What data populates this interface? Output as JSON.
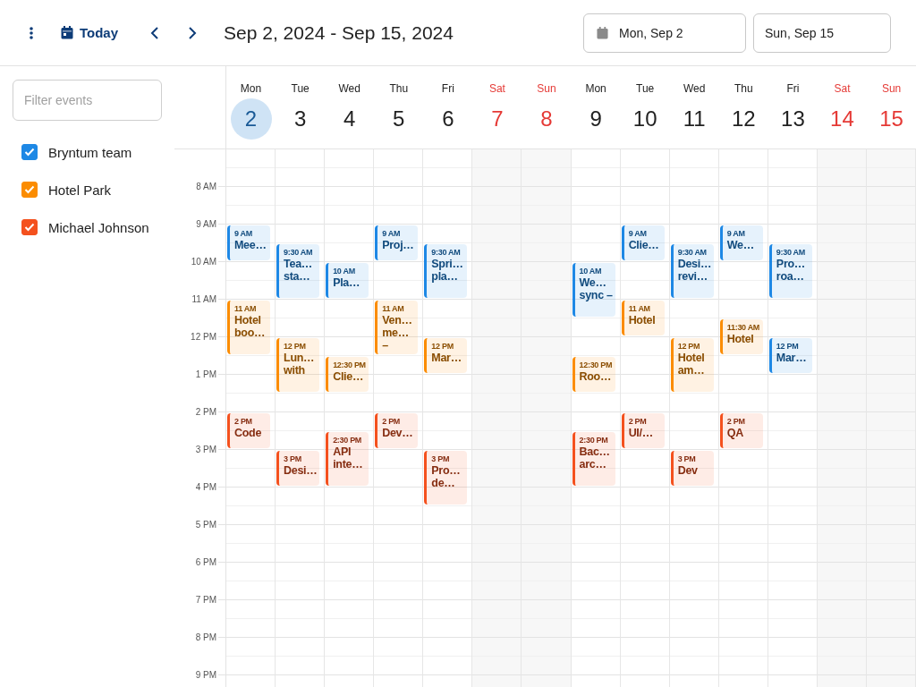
{
  "toolbar": {
    "today": "Today",
    "range": "Sep 2, 2024 - Sep 15, 2024",
    "start_date": "Mon, Sep 2",
    "end_date": "Sun, Sep 15"
  },
  "sidebar": {
    "filter_placeholder": "Filter events"
  },
  "calendars": [
    {
      "name": "Bryntum team",
      "checked": true,
      "color": "#1e88e5"
    },
    {
      "name": "Hotel Park",
      "checked": true,
      "color": "#fb8c00"
    },
    {
      "name": "Michael Johnson",
      "checked": true,
      "color": "#f4511e"
    }
  ],
  "days": [
    {
      "dow": "Mon",
      "date": "2",
      "weekend": false,
      "selected": true,
      "events": [
        {
          "color": "#1e88e5",
          "kind": "short",
          "time": "9 AM",
          "title": "Mee…"
        },
        {
          "color": "#fb8c00",
          "kind": "long",
          "time": "11 AM",
          "title": "Hotel boo…"
        },
        {
          "color": "#f4511e",
          "kind": "short",
          "time": "2 PM",
          "title": "Code"
        }
      ]
    },
    {
      "dow": "Tue",
      "date": "3",
      "weekend": false,
      "selected": false,
      "events": [
        {
          "color": "#1e88e5",
          "kind": "long",
          "time": "9:30 AM",
          "title": "Tea… sta…"
        },
        {
          "color": "#fb8c00",
          "kind": "long",
          "time": "12 PM",
          "title": "Lun… with"
        },
        {
          "color": "#f4511e",
          "kind": "short",
          "time": "3 PM",
          "title": "Desi…"
        }
      ]
    },
    {
      "dow": "Wed",
      "date": "4",
      "weekend": false,
      "selected": false,
      "events": [
        {
          "color": "#1e88e5",
          "kind": "short",
          "time": "10 AM",
          "title": "Pla…"
        },
        {
          "color": "#fb8c00",
          "kind": "short",
          "time": "12:30 PM",
          "title": "Clie…"
        },
        {
          "color": "#f4511e",
          "kind": "long",
          "time": "2:30 PM",
          "title": "API inte…"
        }
      ]
    },
    {
      "dow": "Thu",
      "date": "5",
      "weekend": false,
      "selected": false,
      "events": [
        {
          "color": "#1e88e5",
          "kind": "short",
          "time": "9 AM",
          "title": "Proj…"
        },
        {
          "color": "#fb8c00",
          "kind": "long",
          "time": "11 AM",
          "title": "Ven… me… –"
        },
        {
          "color": "#f4511e",
          "kind": "short",
          "time": "2 PM",
          "title": "Dev…"
        }
      ]
    },
    {
      "dow": "Fri",
      "date": "6",
      "weekend": false,
      "selected": false,
      "events": [
        {
          "color": "#1e88e5",
          "kind": "long",
          "time": "9:30 AM",
          "title": "Spri… pla…"
        },
        {
          "color": "#fb8c00",
          "kind": "short",
          "time": "12 PM",
          "title": "Mar…"
        },
        {
          "color": "#f4511e",
          "kind": "long",
          "time": "3 PM",
          "title": "Pro… de…"
        }
      ]
    },
    {
      "dow": "Sat",
      "date": "7",
      "weekend": true,
      "selected": false
    },
    {
      "dow": "Sun",
      "date": "8",
      "weekend": true,
      "selected": false
    },
    {
      "dow": "Mon",
      "date": "9",
      "weekend": false,
      "selected": false,
      "events": [
        {
          "color": "#1e88e5",
          "kind": "long",
          "time": "10 AM",
          "title": "We… sync –"
        },
        {
          "color": "#fb8c00",
          "kind": "short",
          "time": "12:30 PM",
          "title": "Roo…"
        },
        {
          "color": "#f4511e",
          "kind": "long",
          "time": "2:30 PM",
          "title": "Bac… arc…"
        }
      ]
    },
    {
      "dow": "Tue",
      "date": "10",
      "weekend": false,
      "selected": false,
      "events": [
        {
          "color": "#1e88e5",
          "kind": "short",
          "time": "9 AM",
          "title": "Clie…"
        },
        {
          "color": "#fb8c00",
          "kind": "short",
          "time": "11 AM",
          "title": "Hotel"
        },
        {
          "color": "#f4511e",
          "kind": "short",
          "time": "2 PM",
          "title": "UI/…"
        }
      ]
    },
    {
      "dow": "Wed",
      "date": "11",
      "weekend": false,
      "selected": false,
      "events": [
        {
          "color": "#1e88e5",
          "kind": "long",
          "time": "9:30 AM",
          "title": "Desi… revi…"
        },
        {
          "color": "#fb8c00",
          "kind": "long",
          "time": "12 PM",
          "title": "Hotel am…"
        },
        {
          "color": "#f4511e",
          "kind": "short",
          "time": "3 PM",
          "title": "Dev"
        }
      ]
    },
    {
      "dow": "Thu",
      "date": "12",
      "weekend": false,
      "selected": false,
      "events": [
        {
          "color": "#1e88e5",
          "kind": "short",
          "time": "9 AM",
          "title": "We…"
        },
        {
          "color": "#fb8c00",
          "kind": "short",
          "time": "11:30 AM",
          "title": "Hotel"
        },
        {
          "color": "#f4511e",
          "kind": "short",
          "time": "2 PM",
          "title": "QA"
        }
      ]
    },
    {
      "dow": "Fri",
      "date": "13",
      "weekend": false,
      "selected": false,
      "events": [
        {
          "color": "#1e88e5",
          "kind": "long",
          "time": "9:30 AM",
          "title": "Pro… roa…"
        },
        {
          "color": "#1e88e5",
          "kind": "short",
          "time": "12 PM",
          "title": "Mar…"
        }
      ]
    },
    {
      "dow": "Sat",
      "date": "14",
      "weekend": true,
      "selected": false
    },
    {
      "dow": "Sun",
      "date": "15",
      "weekend": true,
      "selected": false
    }
  ],
  "hours": [
    "8 AM",
    "9 AM",
    "10 AM",
    "11 AM",
    "12 PM",
    "1 PM",
    "2 PM",
    "3 PM",
    "4 PM",
    "5 PM",
    "6 PM",
    "7 PM",
    "8 PM",
    "9 PM"
  ]
}
